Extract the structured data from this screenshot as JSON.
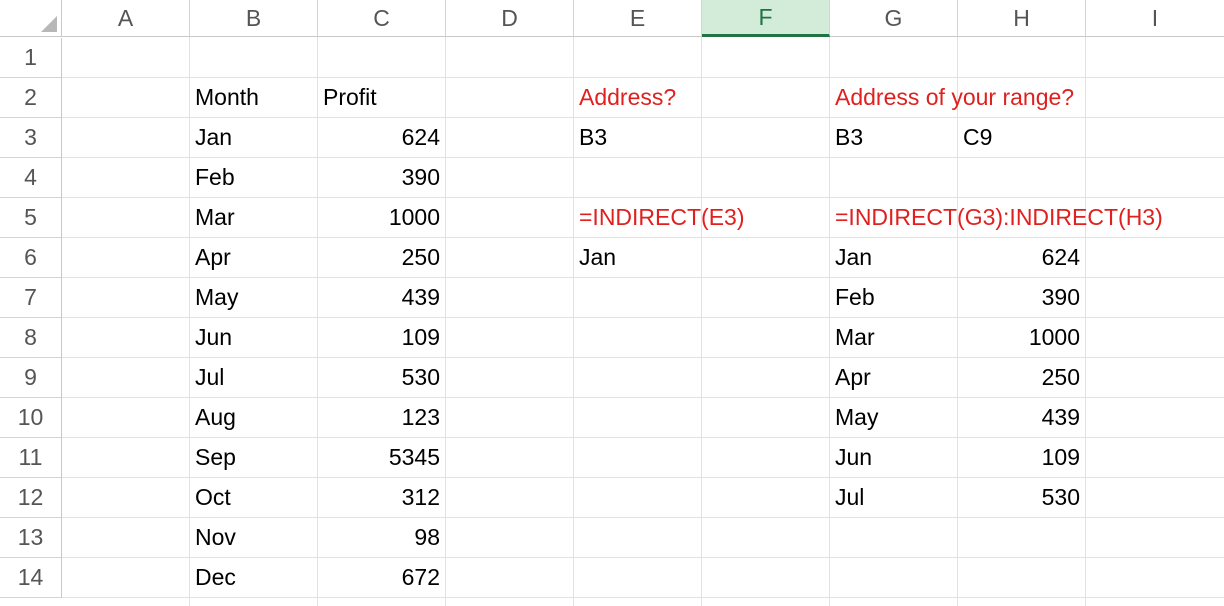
{
  "columns": [
    "A",
    "B",
    "C",
    "D",
    "E",
    "F",
    "G",
    "H",
    "I"
  ],
  "selected_column": "F",
  "rows": [
    "1",
    "2",
    "3",
    "4",
    "5",
    "6",
    "7",
    "8",
    "9",
    "10",
    "11",
    "12",
    "13",
    "14"
  ],
  "colors": {
    "red_text": "#e0201e",
    "selected_header_fill": "#d3ecd9",
    "selected_header_accent": "#217346"
  },
  "cells": {
    "B2": "Month",
    "C2": "Profit",
    "B3": "Jan",
    "C3": "624",
    "B4": "Feb",
    "C4": "390",
    "B5": "Mar",
    "C5": "1000",
    "B6": "Apr",
    "C6": "250",
    "B7": "May",
    "C7": "439",
    "B8": "Jun",
    "C8": "109",
    "B9": "Jul",
    "C9": "530",
    "B10": "Aug",
    "C10": "123",
    "B11": "Sep",
    "C11": "5345",
    "B12": "Oct",
    "C12": "312",
    "B13": "Nov",
    "C13": "98",
    "B14": "Dec",
    "C14": "672",
    "E2": "Address?",
    "E3": "B3",
    "E5": "=INDIRECT(E3)",
    "E6": "Jan",
    "G2": "Address of your range?",
    "G3": "B3",
    "H3": "C9",
    "G5": "=INDIRECT(G3):INDIRECT(H3)",
    "G6": "Jan",
    "H6": "624",
    "G7": "Feb",
    "H7": "390",
    "G8": "Mar",
    "H8": "1000",
    "G9": "Apr",
    "H9": "250",
    "G10": "May",
    "H10": "439",
    "G11": "Jun",
    "H11": "109",
    "G12": "Jul",
    "H12": "530"
  }
}
